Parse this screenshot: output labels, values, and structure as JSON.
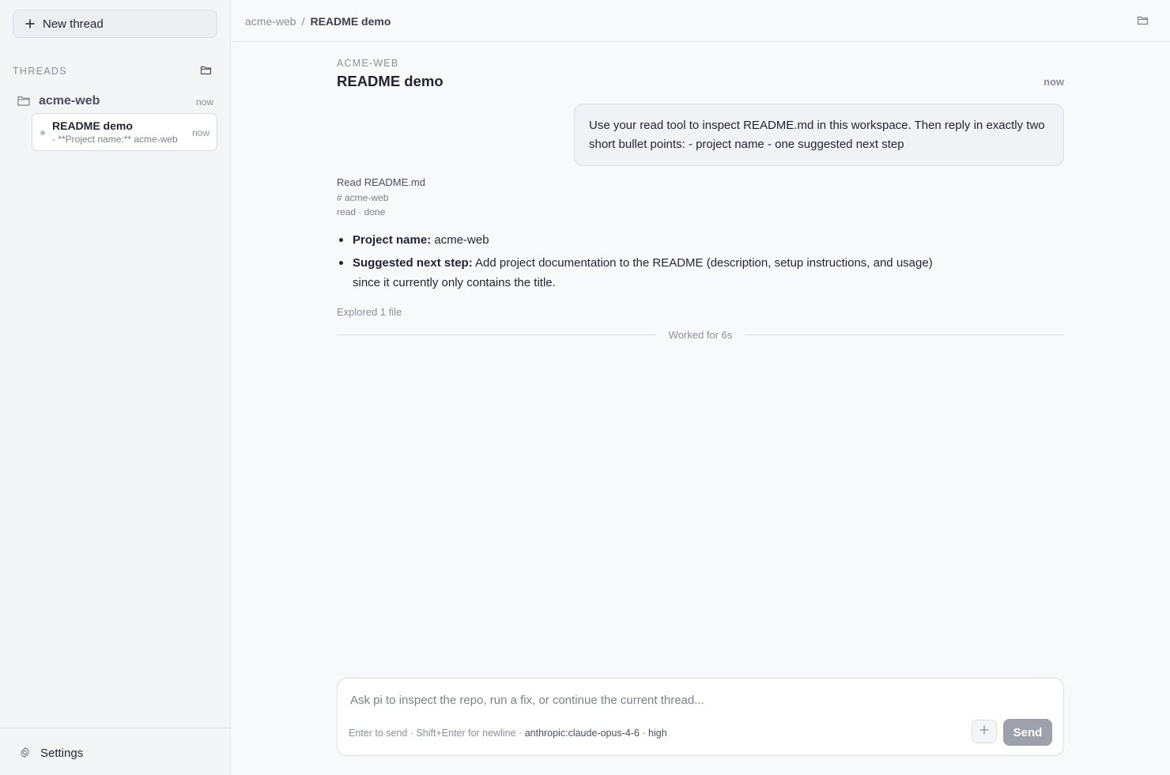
{
  "sidebar": {
    "new_thread_label": "New thread",
    "threads_label": "THREADS",
    "project": {
      "name": "acme-web",
      "time": "now"
    },
    "thread": {
      "title": "README demo",
      "preview": "- **Project name:** acme-web",
      "time": "now"
    },
    "settings_label": "Settings"
  },
  "topbar": {
    "breadcrumb_project": "acme-web",
    "breadcrumb_sep": "/",
    "breadcrumb_current": "README demo"
  },
  "conversation": {
    "eyebrow": "ACME-WEB",
    "title": "README demo",
    "time": "now",
    "user_message": "Use your read tool to inspect README.md in this workspace. Then reply in exactly two short bullet points: - project name - one suggested next step",
    "tool": {
      "title": "Read README.md",
      "output": "# acme-web",
      "status": "read · done"
    },
    "answer": [
      {
        "label": "Project name:",
        "text": " acme-web"
      },
      {
        "label": "Suggested next step:",
        "text": " Add project documentation to the README (description, setup instructions, and usage) since it currently only contains the title."
      }
    ],
    "explored": "Explored 1 file",
    "worked": "Worked for 6s"
  },
  "composer": {
    "placeholder": "Ask pi to inspect the repo, run a fix, or continue the current thread...",
    "hint": "Enter to send · Shift+Enter for newline · ",
    "model": "anthropic:claude-opus-4-6 · high",
    "send_label": "Send"
  },
  "icons": {
    "new_thread": "plus-icon",
    "threads_folder": "folder-icon",
    "project": "folder-icon",
    "topbar": "folder-icon",
    "settings": "gear-icon",
    "attach": "plus-icon"
  },
  "colors": {
    "background": "#f8f9fb",
    "sidebar": "#f4f5f7",
    "send_button": "#9da1aa",
    "text": "#1f2430",
    "muted": "#8a8f9a"
  }
}
